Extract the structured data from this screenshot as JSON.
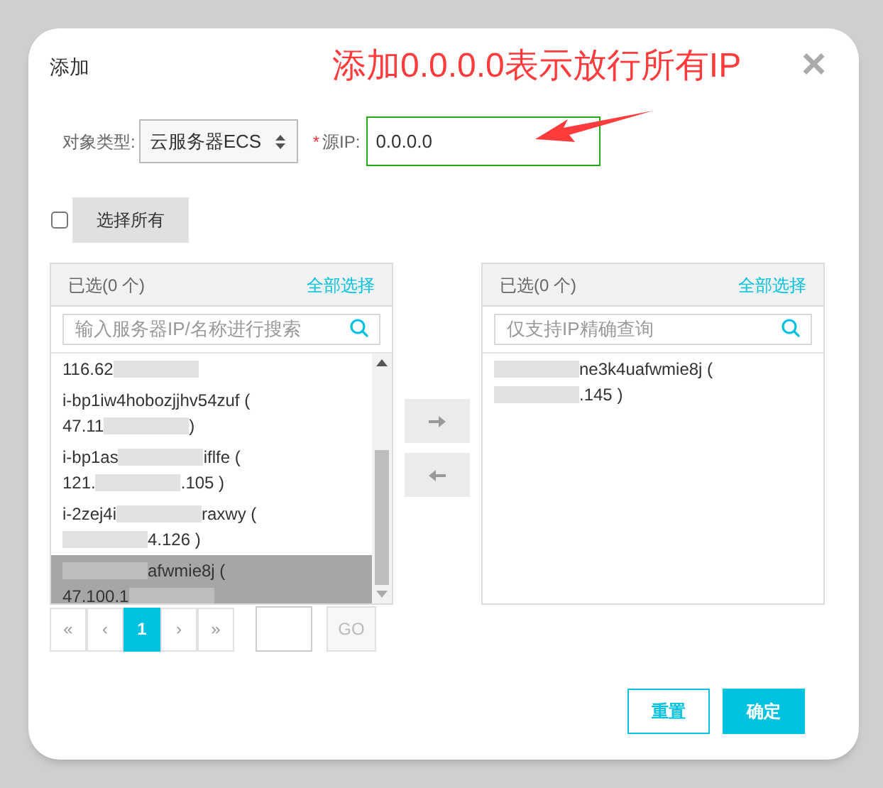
{
  "dialog": {
    "title": "添加",
    "close": "×"
  },
  "annotation": {
    "text": "添加0.0.0.0表示放行所有IP"
  },
  "form": {
    "type_label": "对象类型:",
    "type_value": "云服务器ECS",
    "ip_required": "*",
    "ip_label": "源IP:",
    "ip_value": "0.0.0.0"
  },
  "select_all": {
    "checked": false,
    "label": "选择所有"
  },
  "left_panel": {
    "header": "已选(0 个)",
    "select_all_link": "全部选择",
    "search_placeholder": "输入服务器IP/名称进行搜索",
    "items": [
      {
        "selected": false,
        "lines": [
          [
            {
              "kind": "text",
              "text": "116.62"
            },
            {
              "kind": "blur"
            }
          ]
        ]
      },
      {
        "selected": false,
        "lines": [
          [
            {
              "kind": "text",
              "text": "i-bp1iw4hobozjjhv54zuf ("
            }
          ],
          [
            {
              "kind": "text",
              "text": "47.11"
            },
            {
              "kind": "blur"
            },
            {
              "kind": "text",
              "text": ")"
            }
          ]
        ]
      },
      {
        "selected": false,
        "lines": [
          [
            {
              "kind": "text",
              "text": "i-bp1as"
            },
            {
              "kind": "blur"
            },
            {
              "kind": "text",
              "text": "iflfe ("
            }
          ],
          [
            {
              "kind": "text",
              "text": "121."
            },
            {
              "kind": "blur"
            },
            {
              "kind": "text",
              "text": ".105 )"
            }
          ]
        ]
      },
      {
        "selected": false,
        "lines": [
          [
            {
              "kind": "text",
              "text": "i-2zej4i"
            },
            {
              "kind": "blur"
            },
            {
              "kind": "text",
              "text": "raxwy ("
            }
          ],
          [
            {
              "kind": "blur"
            },
            {
              "kind": "text",
              "text": "4.126 )"
            }
          ]
        ]
      },
      {
        "selected": true,
        "lines": [
          [
            {
              "kind": "blur"
            },
            {
              "kind": "text",
              "text": "afwmie8j ("
            }
          ],
          [
            {
              "kind": "text",
              "text": "47.100.1"
            },
            {
              "kind": "blur"
            }
          ]
        ]
      }
    ]
  },
  "transfer_buttons": [
    {
      "kind": "right"
    },
    {
      "kind": "left"
    }
  ],
  "right_panel": {
    "header": "已选(0 个)",
    "select_all_link": "全部选择",
    "search_placeholder": "仅支持IP精确查询",
    "items": [
      {
        "selected": false,
        "lines": [
          [
            {
              "kind": "blur"
            },
            {
              "kind": "text",
              "text": "ne3k4uafwmie8j ("
            }
          ],
          [
            {
              "kind": "blur"
            },
            {
              "kind": "text",
              "text": ".145 )"
            }
          ]
        ]
      }
    ]
  },
  "pagination": {
    "pages": [
      {
        "label": "«",
        "selected": false
      },
      {
        "label": "‹",
        "selected": false
      },
      {
        "label": "1",
        "selected": true
      },
      {
        "label": "›",
        "selected": false
      },
      {
        "label": "»",
        "selected": false
      }
    ],
    "go": "GO"
  },
  "buttons": [
    {
      "label": "重置",
      "kind": "secondary"
    },
    {
      "label": "确定",
      "kind": "primary"
    }
  ]
}
